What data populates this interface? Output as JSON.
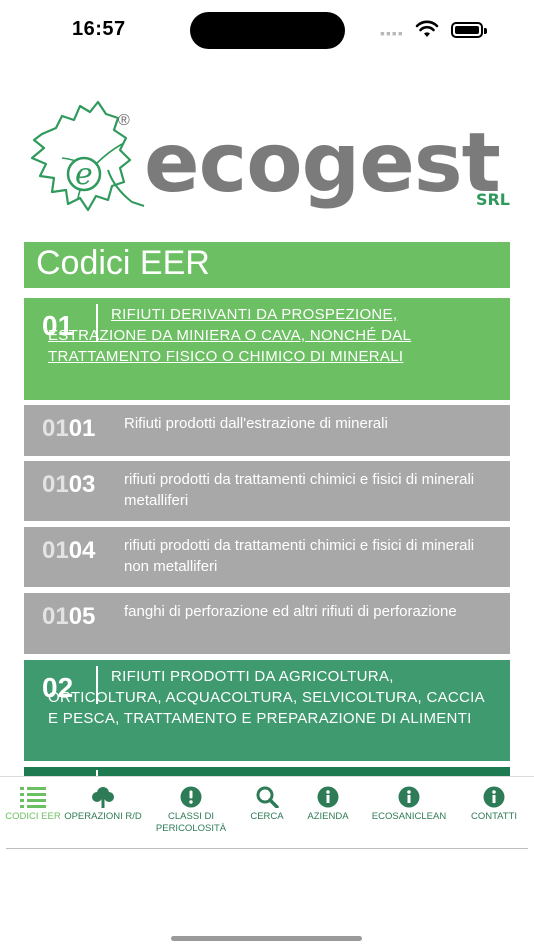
{
  "status": {
    "time": "16:57"
  },
  "brand": {
    "name": "ecogest",
    "suffix": "SRL",
    "reg": "®"
  },
  "page": {
    "title": "Codici EER"
  },
  "list": [
    {
      "kind": "section",
      "code": "01",
      "text": "RIFIUTI DERIVANTI DA PROSPEZIONE, ESTRAZIONE DA MINIERA O CAVA, NONCHÉ DAL TRATTAMENTO FISICO O CHIMICO DI MINERALI",
      "color": "#6dbf63",
      "underline": true
    },
    {
      "kind": "sub",
      "code_prefix": "01",
      "code_suffix": "01",
      "text": "Rifiuti prodotti dall'estrazione di minerali",
      "color": "#a8a8a8"
    },
    {
      "kind": "sub",
      "code_prefix": "01",
      "code_suffix": "03",
      "text": "rifiuti prodotti da trattamenti chimici e fisici di minerali metalliferi",
      "color": "#a8a8a8"
    },
    {
      "kind": "sub",
      "code_prefix": "01",
      "code_suffix": "04",
      "text": "rifiuti prodotti da trattamenti chimici e fisici di minerali non metalliferi",
      "color": "#a8a8a8"
    },
    {
      "kind": "sub",
      "code_prefix": "01",
      "code_suffix": "05",
      "text": "fanghi di perforazione ed altri rifiuti di perforazione",
      "color": "#a8a8a8"
    },
    {
      "kind": "section",
      "code": "02",
      "text": "RIFIUTI PRODOTTI DA AGRICOLTURA, ORTICOLTURA, ACQUACOLTURA, SELVICOLTURA, CACCIA E PESCA, TRATTAMENTO E PREPARAZIONE DI ALIMENTI",
      "color": "#3f9a70",
      "underline": false
    }
  ],
  "tabs": [
    {
      "label": "CODICI EER",
      "icon": "list-icon",
      "active": true
    },
    {
      "label": "OPERAZIONI R/D",
      "icon": "tree-icon",
      "active": false
    },
    {
      "label": "CLASSI DI PERICOLOSITÀ",
      "icon": "exclamation-icon",
      "active": false
    },
    {
      "label": "CERCA",
      "icon": "search-icon",
      "active": false
    },
    {
      "label": "AZIENDA",
      "icon": "info-icon",
      "active": false
    },
    {
      "label": "ECOSANICLEAN",
      "icon": "info-icon",
      "active": false
    },
    {
      "label": "CONTATTI",
      "icon": "info-icon",
      "active": false
    }
  ],
  "colors": {
    "green_light": "#6dbf63",
    "green_mid": "#3f9a70",
    "green_dark": "#1e7a50",
    "gray": "#a8a8a8",
    "tab_icon": "#2e7b57"
  }
}
